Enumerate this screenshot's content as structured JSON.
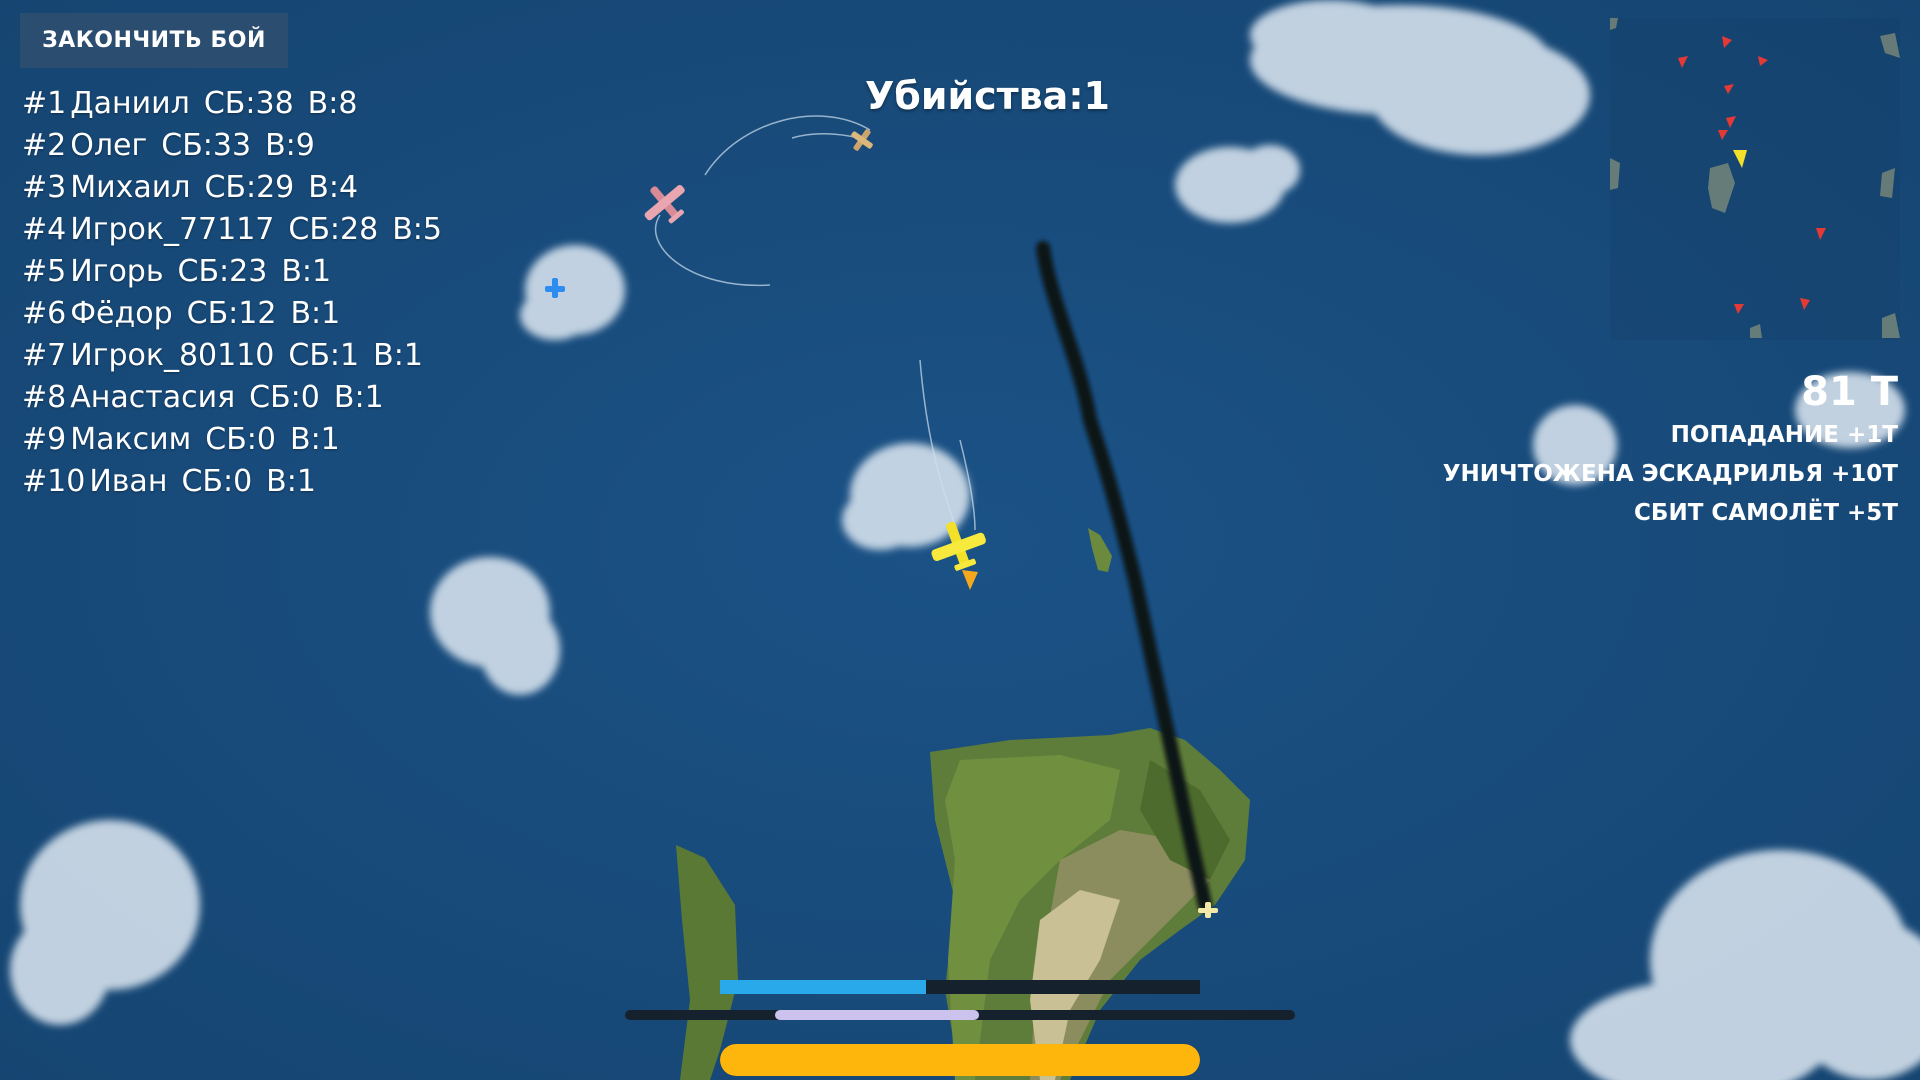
{
  "ui": {
    "end_battle_label": "ЗАКОНЧИТЬ БОЙ",
    "kills_text": "Убийства:1"
  },
  "leaderboard": [
    {
      "rank": "#1",
      "name": "Даниил",
      "sb": "СБ:38",
      "v": "В:8"
    },
    {
      "rank": "#2",
      "name": "Олег",
      "sb": "СБ:33",
      "v": "В:9"
    },
    {
      "rank": "#3",
      "name": "Михаил",
      "sb": "СБ:29",
      "v": "В:4"
    },
    {
      "rank": "#4",
      "name": "Игрок_77117",
      "sb": "СБ:28",
      "v": "В:5"
    },
    {
      "rank": "#5",
      "name": "Игорь",
      "sb": "СБ:23",
      "v": "В:1"
    },
    {
      "rank": "#6",
      "name": "Фёдор",
      "sb": "СБ:12",
      "v": "В:1"
    },
    {
      "rank": "#7",
      "name": "Игрок_80110",
      "sb": "СБ:1",
      "v": "В:1"
    },
    {
      "rank": "#8",
      "name": "Анастасия",
      "sb": "СБ:0",
      "v": "В:1"
    },
    {
      "rank": "#9",
      "name": "Максим",
      "sb": "СБ:0",
      "v": "В:1"
    },
    {
      "rank": "#10",
      "name": "Иван",
      "sb": "СБ:0",
      "v": "В:1"
    }
  ],
  "score": {
    "total": "81 Т",
    "events": [
      "ПОПАДАНИЕ +1Т",
      "УНИЧТОЖЕНА ЭСКАДРИЛЬЯ +10Т",
      "СБИТ САМОЛЁТ +5Т"
    ]
  },
  "bars": [
    {
      "name": "boost-bar",
      "fraction": 0.43,
      "color": "#29a9ea"
    },
    {
      "name": "energy-bar",
      "fraction": 0.55,
      "color": "#ccc2ee"
    },
    {
      "name": "health-bar",
      "fraction": 1.0,
      "color": "#ffb60c"
    }
  ],
  "colors": {
    "ocean": "#1a4e7e",
    "player_plane": "#f2e128",
    "enemy_marker": "#e53935",
    "cloud": "#dfe9f3",
    "island": "#5f7d3a"
  }
}
